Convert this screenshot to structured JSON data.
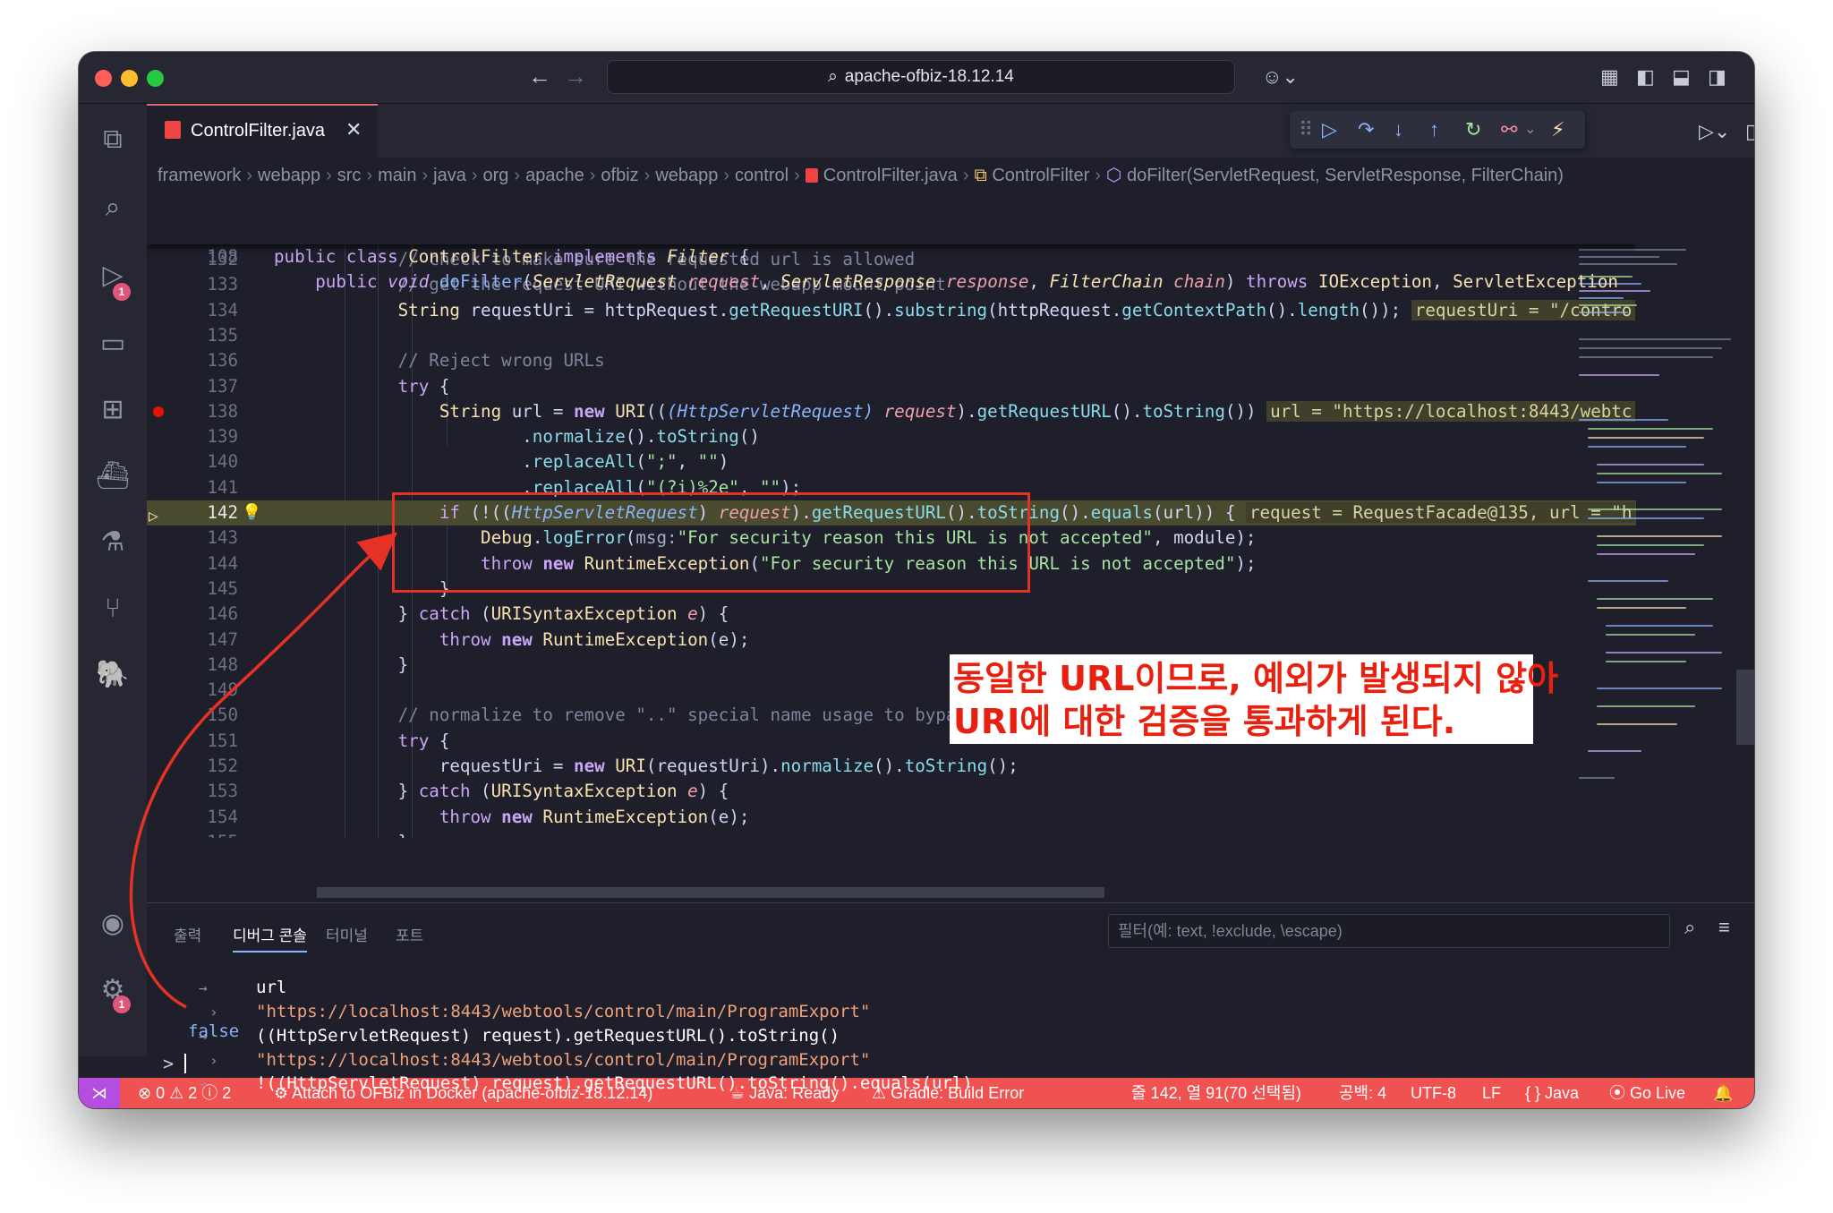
{
  "titlebar": {
    "search_text": "apache-ofbiz-18.12.14"
  },
  "tab": {
    "filename": "ControlFilter.java"
  },
  "breadcrumb": {
    "items": [
      "framework",
      "webapp",
      "src",
      "main",
      "java",
      "org",
      "apache",
      "ofbiz",
      "webapp",
      "control"
    ],
    "file": "ControlFilter.java",
    "class": "ControlFilter",
    "method": "doFilter(ServletRequest, ServletResponse, FilterChain)"
  },
  "editor": {
    "sticky": [
      {
        "num": "67"
      },
      {
        "num": "108"
      }
    ],
    "line_numbers": [
      "132",
      "133",
      "134",
      "135",
      "136",
      "137",
      "138",
      "139",
      "140",
      "141",
      "142",
      "143",
      "144",
      "145",
      "146",
      "147",
      "148",
      "149",
      "150",
      "151",
      "152",
      "153",
      "154",
      "155"
    ],
    "inline_values": {
      "l134": "requestUri = \"/contro",
      "l138": "url = \"https://localhost:8443/webtc",
      "l142": "request = RequestFacade@135, url = \"h"
    }
  },
  "annotation": {
    "line1": "동일한 URL이므로, 예외가 발생되지 않아",
    "line2": "URI에 대한 검증을 통과하게 된다."
  },
  "panel": {
    "tabs": [
      "출력",
      "디버그 콘솔",
      "터미널",
      "포트"
    ],
    "active_tab": "디버그 콘솔",
    "filter_placeholder": "필터(예: text, !exclude, \\escape)",
    "console": [
      {
        "prefix": "→",
        "text": "url"
      },
      {
        "prefix": "›",
        "text": "\"https://localhost:8443/webtools/control/main/ProgramExport\""
      },
      {
        "prefix": "→",
        "text": "((HttpServletRequest) request).getRequestURL().toString()"
      },
      {
        "prefix": "›",
        "text": "\"https://localhost:8443/webtools/control/main/ProgramExport\""
      },
      {
        "prefix": "→",
        "text": "!((HttpServletRequest) request).getRequestURL().toString().equals(url)"
      },
      {
        "prefix": "",
        "text": "false"
      }
    ],
    "input_prompt": ">"
  },
  "statusbar": {
    "errors": "0",
    "warnings": "2",
    "infos": "2",
    "attach": "Attach to OFBiz in Docker (apache-ofbiz-18.12.14)",
    "java": "Java: Ready",
    "gradle": "Gradle: Build Error",
    "position": "줄 142, 열 91(70 선택됨)",
    "spaces": "공백: 4",
    "encoding": "UTF-8",
    "eol": "LF",
    "language": "Java",
    "golive": "Go Live"
  },
  "activity_badges": {
    "debug": "1",
    "settings": "1"
  },
  "colors": {
    "status_bar": "#f05151",
    "annotation_red": "#e53224",
    "remote": "#b54de0"
  }
}
